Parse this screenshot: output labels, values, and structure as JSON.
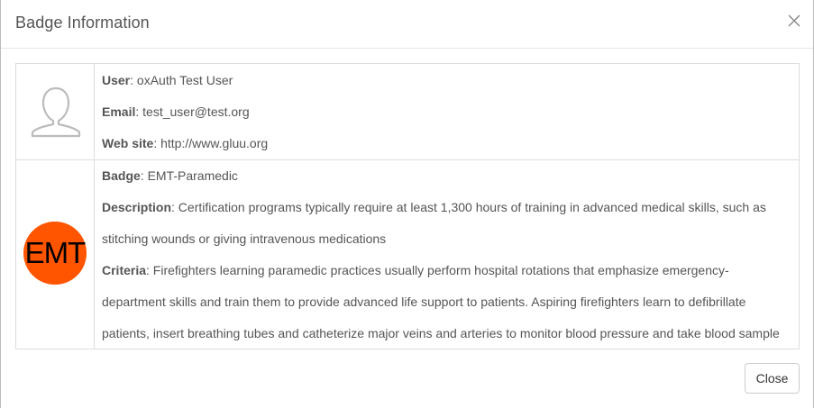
{
  "dialog": {
    "title": "Badge Information",
    "close_button_label": "Close"
  },
  "user": {
    "user_label": "User",
    "user_value": ": oxAuth Test User",
    "email_label": "Email",
    "email_value": ": test_user@test.org",
    "website_label": "Web site",
    "website_value": ": http://www.gluu.org"
  },
  "badge": {
    "image_text": "EMT",
    "badge_label": "Badge",
    "badge_value": ": EMT-Paramedic",
    "description_label": "Description",
    "description_line1": ": Certification programs typically require at least 1,300 hours of training in advanced medical skills, such as",
    "description_line2": "stitching wounds or giving intravenous medications",
    "criteria_label": "Criteria",
    "criteria_line1": ": Firefighters learning paramedic practices usually perform hospital rotations that emphasize emergency-",
    "criteria_line2": "department skills and train them to provide advanced life support to patients. Aspiring firefighters learn to defibrillate",
    "criteria_line3": "patients, insert breathing tubes and catheterize major veins and arteries to monitor blood pressure and take blood sample"
  },
  "colors": {
    "badge_circle": "#ff5400",
    "text": "#555555"
  },
  "icons": {
    "close": "close-icon",
    "avatar": "user-avatar-icon"
  }
}
